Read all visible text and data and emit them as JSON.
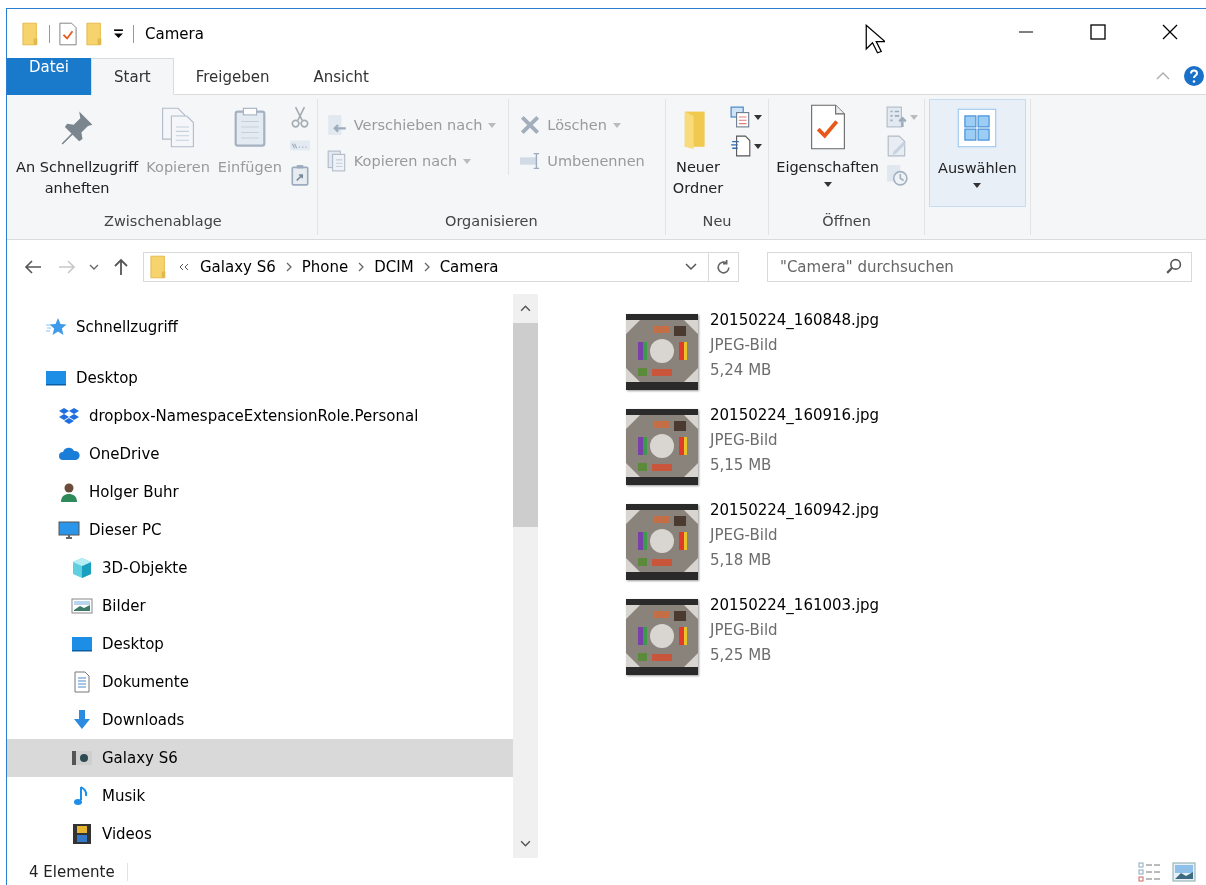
{
  "window": {
    "title": "Camera"
  },
  "ribbon_tabs": [
    {
      "label": "Datei",
      "kind": "file",
      "selected": false
    },
    {
      "label": "Start",
      "kind": "tab",
      "selected": true
    },
    {
      "label": "Freigeben",
      "kind": "tab",
      "selected": false
    },
    {
      "label": "Ansicht",
      "kind": "tab",
      "selected": false
    }
  ],
  "ribbon_groups": [
    {
      "label": "Zwischenablage",
      "columns": [
        [
          {
            "kind": "large",
            "label": "An Schnellzugriff\nanheften",
            "disabled": false
          }
        ],
        [
          {
            "kind": "large",
            "label": "Kopieren",
            "disabled": true
          }
        ],
        [
          {
            "kind": "large",
            "label": "Einfügen",
            "disabled": true
          }
        ],
        [
          {
            "kind": "icon",
            "disabled": true
          },
          {
            "kind": "icon",
            "disabled": true
          },
          {
            "kind": "icon",
            "disabled": true
          }
        ]
      ]
    },
    {
      "label": "Organisieren",
      "columns": [
        [
          {
            "kind": "small",
            "label": "Verschieben nach",
            "disabled": true,
            "dropdown": true
          },
          {
            "kind": "small",
            "label": "Kopieren nach",
            "disabled": true,
            "dropdown": true
          }
        ],
        [
          {
            "kind": "small",
            "label": "Löschen",
            "disabled": true,
            "dropdown": true
          },
          {
            "kind": "small",
            "label": "Umbenennen",
            "disabled": true
          }
        ]
      ]
    },
    {
      "label": "Neu",
      "columns": [
        [
          {
            "kind": "large",
            "label": "Neuer\nOrdner",
            "disabled": false
          }
        ],
        [
          {
            "kind": "icon",
            "disabled": false,
            "dropdown": true
          },
          {
            "kind": "icon",
            "disabled": false,
            "dropdown": true
          }
        ]
      ]
    },
    {
      "label": "Öffnen",
      "columns": [
        [
          {
            "kind": "large",
            "label": "Eigenschaften",
            "disabled": false,
            "dropdown": true
          }
        ],
        [
          {
            "kind": "icon",
            "disabled": true,
            "dropdown": true
          },
          {
            "kind": "icon",
            "disabled": true
          },
          {
            "kind": "icon",
            "disabled": true
          }
        ]
      ]
    },
    {
      "columns": [
        [
          {
            "kind": "large",
            "label": "Auswählen",
            "disabled": false,
            "dropdown": true,
            "highlighted": true
          }
        ]
      ]
    }
  ],
  "address_bar": {
    "crumbs": [
      "Galaxy S6",
      "Phone",
      "DCIM",
      "Camera"
    ]
  },
  "search": {
    "placeholder": "\"Camera\" durchsuchen"
  },
  "navigation": [
    {
      "label": "Schnellzugriff",
      "selected": false
    },
    {
      "label": "Desktop",
      "selected": false,
      "children": [
        {
          "label": "dropbox-NamespaceExtensionRole.Personal",
          "selected": false
        },
        {
          "label": "OneDrive",
          "selected": false
        },
        {
          "label": "Holger Buhr",
          "selected": false
        },
        {
          "label": "Dieser PC",
          "selected": false,
          "children": [
            {
              "label": "3D-Objekte",
              "selected": false
            },
            {
              "label": "Bilder",
              "selected": false
            },
            {
              "label": "Desktop",
              "selected": false
            },
            {
              "label": "Dokumente",
              "selected": false
            },
            {
              "label": "Downloads",
              "selected": false
            },
            {
              "label": "Galaxy S6",
              "selected": true
            },
            {
              "label": "Musik",
              "selected": false
            },
            {
              "label": "Videos",
              "selected": false
            }
          ]
        }
      ]
    }
  ],
  "files": [
    {
      "name": "20150224_160848.jpg",
      "type": "JPEG-Bild",
      "size": "5,24 MB"
    },
    {
      "name": "20150224_160916.jpg",
      "type": "JPEG-Bild",
      "size": "5,15 MB"
    },
    {
      "name": "20150224_160942.jpg",
      "type": "JPEG-Bild",
      "size": "5,18 MB"
    },
    {
      "name": "20150224_161003.jpg",
      "type": "JPEG-Bild",
      "size": "5,25 MB"
    }
  ],
  "status_bar": {
    "item_count": "4 Elemente"
  }
}
